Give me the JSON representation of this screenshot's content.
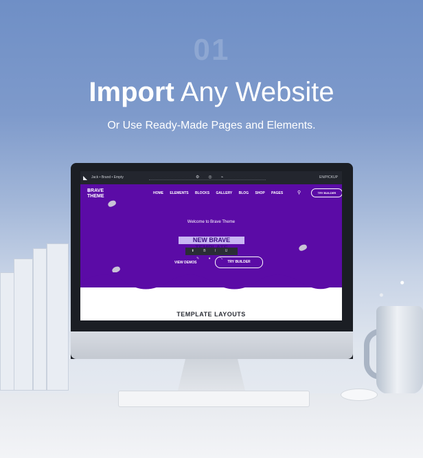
{
  "header": {
    "step_number": "01",
    "title_bold": "Import",
    "title_light": "Any Website",
    "subtitle": "Or Use Ready-Made Pages and Elements."
  },
  "editor_toolbar": {
    "url_text": "Jack • Brand • Empty",
    "icons": [
      "settings-icon",
      "palette-icon",
      "pulse-icon"
    ],
    "right_label": "EN/PICKUP"
  },
  "site": {
    "brand_line1": "BRAVE",
    "brand_line2": "THEME",
    "nav": [
      "HOME",
      "ELEMENTS",
      "BLOCKS",
      "GALLERY",
      "BLOG",
      "SHOP",
      "PAGES"
    ],
    "top_button": "TRY BUILDER",
    "welcome": "Welcome to Brave Theme",
    "hero_title": "NEW BRAVE TEMPLATE",
    "edit_icons": "⬆ B I U ✎ ● ⤡",
    "view_demos": "VIEW DEMOS",
    "try_builder": "TRY BUILDER",
    "section_title": "TEMPLATE LAYOUTS"
  },
  "colors": {
    "hero_purple": "#5b0ba6",
    "highlight": "#c9b6f3",
    "toolbar_dark": "#23262e"
  }
}
